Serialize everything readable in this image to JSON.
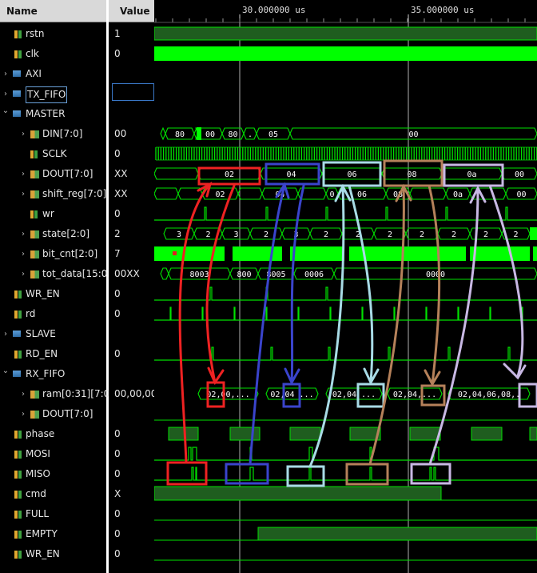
{
  "header": {
    "name_col": "Name",
    "value_col": "Value"
  },
  "timeline": {
    "markers": [
      "30.000000 us",
      "35.000000 us"
    ]
  },
  "signals": [
    {
      "name": "rstn",
      "value": "1",
      "indent": 0,
      "expand": "",
      "kind": "bit"
    },
    {
      "name": "clk",
      "value": "0",
      "indent": 0,
      "expand": "",
      "kind": "bit"
    },
    {
      "name": "AXI",
      "value": "",
      "indent": 0,
      "expand": "closed",
      "kind": "group"
    },
    {
      "name": "TX_FIFO",
      "value": "",
      "indent": 0,
      "expand": "closed",
      "kind": "group"
    },
    {
      "name": "MASTER",
      "value": "",
      "indent": 0,
      "expand": "open",
      "kind": "group"
    },
    {
      "name": "DIN[7:0]",
      "value": "00",
      "indent": 1,
      "expand": "closed",
      "kind": "bus"
    },
    {
      "name": "SCLK",
      "value": "0",
      "indent": 1,
      "expand": "",
      "kind": "bit"
    },
    {
      "name": "DOUT[7:0]",
      "value": "XX",
      "indent": 1,
      "expand": "closed",
      "kind": "bus"
    },
    {
      "name": "shift_reg[7:0]",
      "value": "XX",
      "indent": 1,
      "expand": "closed",
      "kind": "bus"
    },
    {
      "name": "wr",
      "value": "0",
      "indent": 1,
      "expand": "",
      "kind": "bit"
    },
    {
      "name": "state[2:0]",
      "value": "2",
      "indent": 1,
      "expand": "closed",
      "kind": "bus"
    },
    {
      "name": "bit_cnt[2:0]",
      "value": "7",
      "indent": 1,
      "expand": "closed",
      "kind": "bus"
    },
    {
      "name": "tot_data[15:0]",
      "value": "00XX",
      "indent": 1,
      "expand": "closed",
      "kind": "bus"
    },
    {
      "name": "WR_EN",
      "value": "0",
      "indent": 0,
      "expand": "",
      "kind": "bit"
    },
    {
      "name": "rd",
      "value": "0",
      "indent": 0,
      "expand": "",
      "kind": "bit"
    },
    {
      "name": "SLAVE",
      "value": "",
      "indent": 0,
      "expand": "closed",
      "kind": "group"
    },
    {
      "name": "RD_EN",
      "value": "0",
      "indent": 0,
      "expand": "",
      "kind": "bit"
    },
    {
      "name": "RX_FIFO",
      "value": "",
      "indent": 0,
      "expand": "open",
      "kind": "group"
    },
    {
      "name": "ram[0:31][7:0]",
      "value": "00,00,00,",
      "indent": 1,
      "expand": "closed",
      "kind": "bus"
    },
    {
      "name": "DOUT[7:0]",
      "value": "",
      "indent": 1,
      "expand": "closed",
      "kind": "bus"
    },
    {
      "name": "phase",
      "value": "0",
      "indent": 0,
      "expand": "",
      "kind": "bit"
    },
    {
      "name": "MOSI",
      "value": "0",
      "indent": 0,
      "expand": "",
      "kind": "bit"
    },
    {
      "name": "MISO",
      "value": "0",
      "indent": 0,
      "expand": "",
      "kind": "bit"
    },
    {
      "name": "cmd",
      "value": "X",
      "indent": 0,
      "expand": "",
      "kind": "bit"
    },
    {
      "name": "FULL",
      "value": "0",
      "indent": 0,
      "expand": "",
      "kind": "bit"
    },
    {
      "name": "EMPTY",
      "value": "0",
      "indent": 0,
      "expand": "",
      "kind": "bit"
    },
    {
      "name": "WR_EN",
      "value": "0",
      "indent": 0,
      "expand": "",
      "kind": "bit"
    }
  ],
  "wave_labels": {
    "din": [
      "80",
      "00",
      "80",
      ".",
      "05",
      "00"
    ],
    "state": [
      "3",
      "2",
      "3",
      "2",
      "3",
      "2",
      "2",
      "2",
      "2",
      "2",
      "2",
      "2"
    ],
    "tot_data": [
      "8003",
      "800",
      "8005",
      "0006",
      "0000"
    ],
    "dout": [
      "02",
      "04",
      "06",
      "08",
      "0a",
      "00"
    ],
    "shift_reg": [
      "02",
      "04",
      "0",
      "06",
      "08",
      "0a",
      "00"
    ],
    "ram": [
      "02,00,...",
      "02,04 ...",
      "02,04 ...",
      "02,04,...",
      "02,04,06,08,."
    ]
  },
  "colors": {
    "wave": "#00e000",
    "bright": "#00ff00",
    "red": "#ee2222",
    "blue": "#3a44cc",
    "lightblue": "#a8dbe6",
    "brown": "#b5815a",
    "lavender": "#c8b8e4"
  }
}
